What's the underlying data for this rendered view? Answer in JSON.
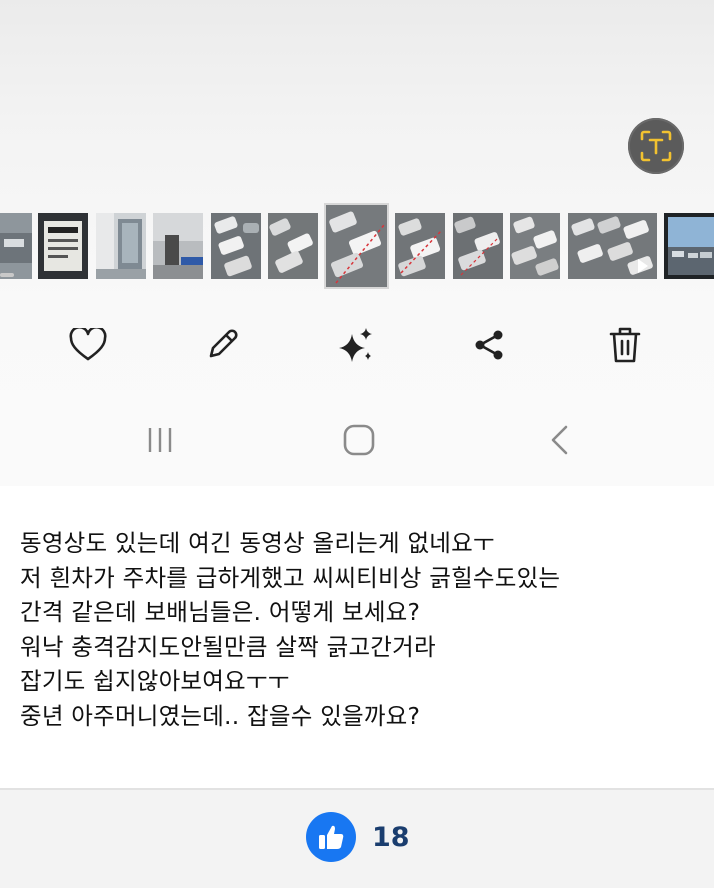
{
  "gallery": {
    "actions": [
      {
        "name": "favorite",
        "icon": "heart-icon"
      },
      {
        "name": "edit",
        "icon": "pencil-icon"
      },
      {
        "name": "ai-enhance",
        "icon": "sparkle-icon"
      },
      {
        "name": "share",
        "icon": "share-icon"
      },
      {
        "name": "delete",
        "icon": "trash-icon"
      }
    ],
    "text_extract_icon": "text-recognition-icon",
    "thumbnail_count": 12,
    "selected_thumbnail": 6
  },
  "system_nav": {
    "recent_icon": "recent-apps-icon",
    "home_icon": "home-icon",
    "back_icon": "back-icon"
  },
  "post": {
    "lines": [
      "동영상도 있는데 여긴 동영상 올리는게 없네요ㅜ",
      "저 흰차가 주차를 급하게했고 씨씨티비상 긁힐수도있는",
      "간격 같은데 보배님들은. 어떻게 보세요?",
      "워낙 충격감지도안될만큼 살짝 긁고간거라",
      "잡기도 쉽지않아보여요ㅜㅜ",
      "중년 아주머니였는데.. 잡을수 있을까요?"
    ]
  },
  "reactions": {
    "like_icon": "thumbs-up-icon",
    "like_count": "18",
    "like_color": "#1877f2"
  }
}
